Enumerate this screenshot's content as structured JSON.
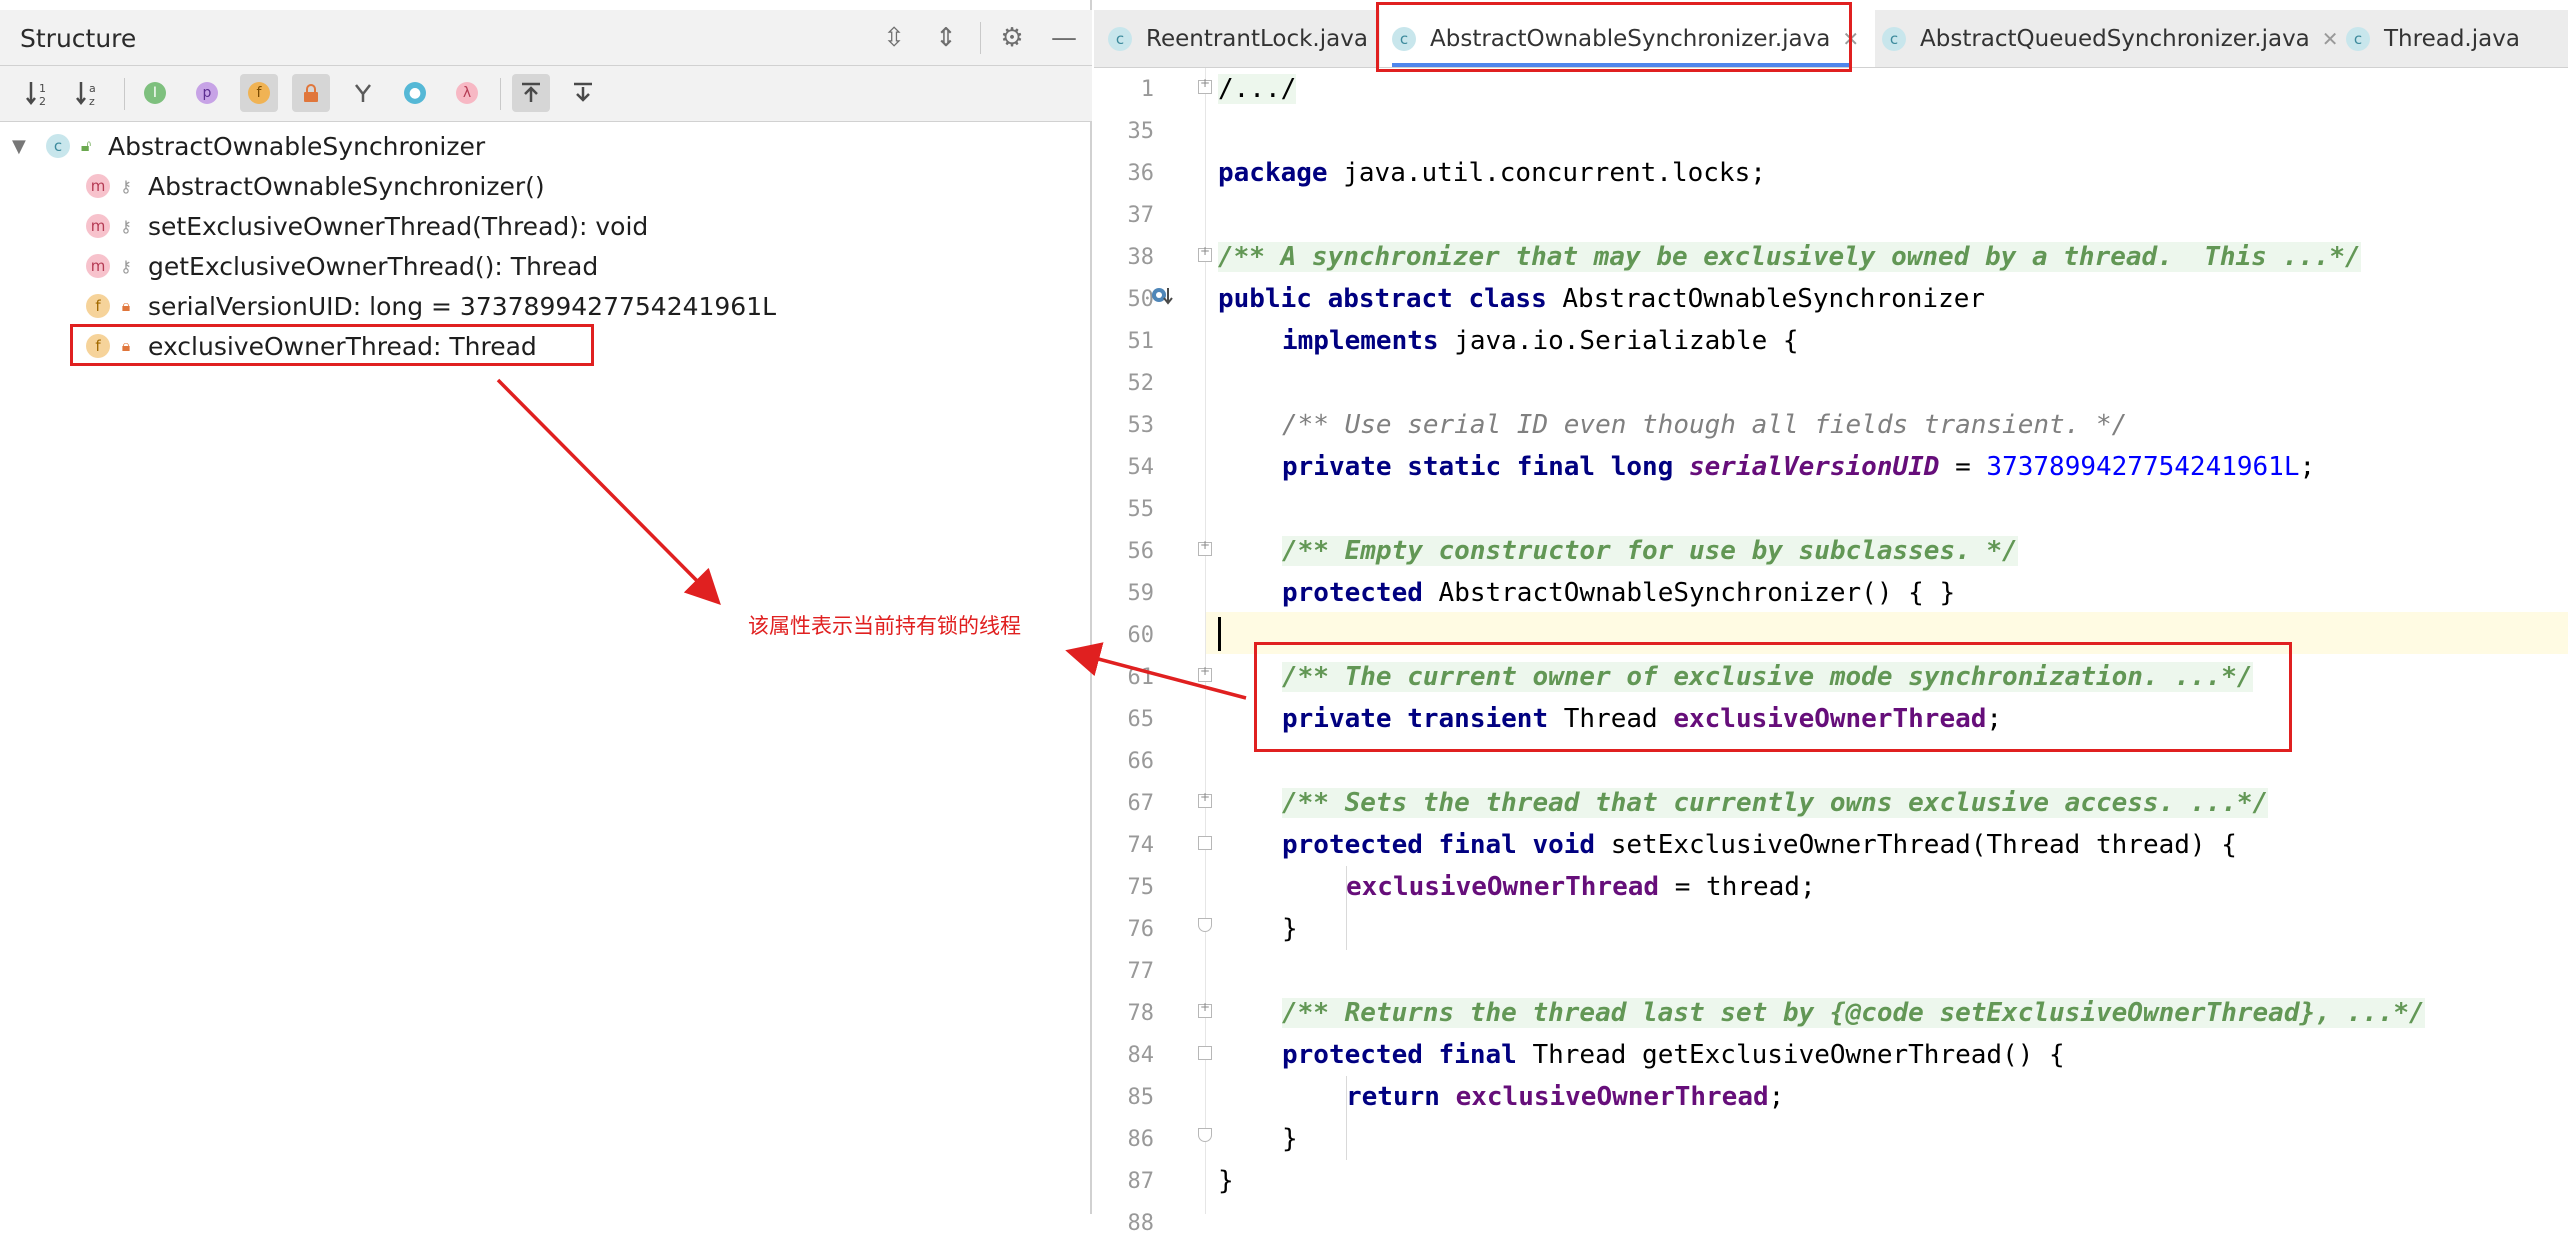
{
  "structure": {
    "title": "Structure",
    "root": "AbstractOwnableSynchronizer",
    "items": [
      {
        "kind": "m",
        "label": "AbstractOwnableSynchronizer()"
      },
      {
        "kind": "m",
        "label": "setExclusiveOwnerThread(Thread): void"
      },
      {
        "kind": "m",
        "label": "getExclusiveOwnerThread(): Thread"
      },
      {
        "kind": "f",
        "label": "serialVersionUID: long = 3737899427754241961L"
      },
      {
        "kind": "f",
        "label": "exclusiveOwnerThread: Thread"
      }
    ],
    "annotation": "该属性表示当前持有锁的线程"
  },
  "tabs": [
    {
      "label": "ReentrantLock.java",
      "active": false
    },
    {
      "label": "AbstractOwnableSynchronizer.java",
      "active": true
    },
    {
      "label": "AbstractQueuedSynchronizer.java",
      "active": false
    },
    {
      "label": "Thread.java",
      "active": false
    }
  ],
  "editor": {
    "line_numbers": [
      "1",
      "35",
      "36",
      "37",
      "38",
      "50",
      "51",
      "52",
      "53",
      "54",
      "55",
      "56",
      "59",
      "60",
      "61",
      "65",
      "66",
      "67",
      "74",
      "75",
      "76",
      "77",
      "78",
      "84",
      "85",
      "86",
      "87",
      "88"
    ],
    "lines": {
      "l1": "/.../",
      "l36_kw": "package",
      "l36_rest": " java.util.concurrent.locks;",
      "l38": "/** A synchronizer that may be exclusively owned by a thread.  This ...*/",
      "l50_kw": "public abstract class",
      "l50_rest": " AbstractOwnableSynchronizer",
      "l51_kw": "implements",
      "l51_rest": " java.io.Serializable {",
      "l53": "/** Use serial ID even though all fields transient. */",
      "l54_kw": "private static final long",
      "l54_fld": "serialVersionUID",
      "l54_eq": " = ",
      "l54_num": "3737899427754241961L",
      "l54_end": ";",
      "l56": "/** Empty constructor for use by subclasses. */",
      "l59_kw": "protected",
      "l59_rest": " AbstractOwnableSynchronizer() { }",
      "l61": "/** The current owner of exclusive mode synchronization. ...*/",
      "l65_kw": "private transient",
      "l65_mid": " Thread ",
      "l65_fld": "exclusiveOwnerThread",
      "l65_end": ";",
      "l67": "/** Sets the thread that currently owns exclusive access. ...*/",
      "l74_kw": "protected final void",
      "l74_rest": " setExclusiveOwnerThread(Thread thread) {",
      "l75_fld": "exclusiveOwnerThread",
      "l75_rest": " = thread;",
      "l76": "}",
      "l78": "/** Returns the thread last set by {@code setExclusiveOwnerThread}, ...*/",
      "l84_kw": "protected final",
      "l84_rest": " Thread getExclusiveOwnerThread() {",
      "l85_kw": "return",
      "l85_sp": " ",
      "l85_fld": "exclusiveOwnerThread",
      "l85_end": ";",
      "l86": "}",
      "l87": "}"
    }
  },
  "colors": {
    "annotation_red": "#e02020",
    "keyword": "#000080",
    "field": "#660e7a",
    "number": "#0000ff",
    "doc_comment": "#629755"
  }
}
